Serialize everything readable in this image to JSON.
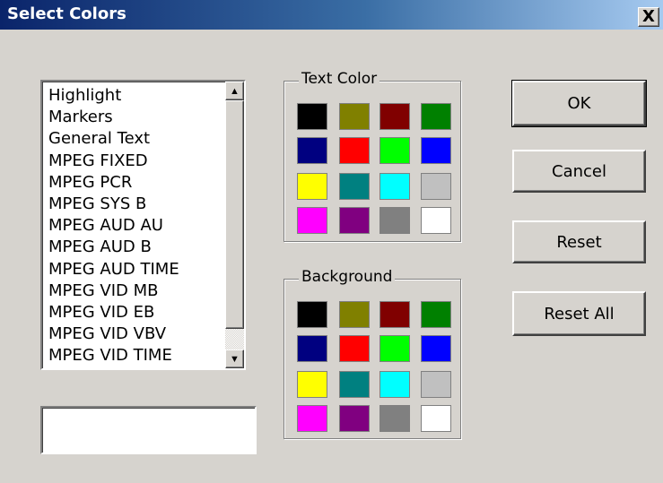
{
  "dialog": {
    "title": "Select Colors",
    "close_glyph": "X"
  },
  "list": {
    "items": [
      "Highlight",
      "Markers",
      "General Text",
      "MPEG FIXED",
      "MPEG PCR",
      "MPEG SYS B",
      "MPEG AUD AU",
      "MPEG AUD B",
      "MPEG AUD TIME",
      "MPEG VID MB",
      "MPEG VID EB",
      "MPEG VID VBV",
      "MPEG VID TIME"
    ]
  },
  "text_color": {
    "label": "Text Color",
    "swatches": [
      "#000000",
      "#808000",
      "#800000",
      "#008000",
      "#000080",
      "#ff0000",
      "#00ff00",
      "#0000ff",
      "#ffff00",
      "#008080",
      "#00ffff",
      "#c0c0c0",
      "#ff00ff",
      "#800080",
      "#808080",
      "#ffffff"
    ]
  },
  "background": {
    "label": "Background",
    "swatches": [
      "#000000",
      "#808000",
      "#800000",
      "#008000",
      "#000080",
      "#ff0000",
      "#00ff00",
      "#0000ff",
      "#ffff00",
      "#008080",
      "#00ffff",
      "#c0c0c0",
      "#ff00ff",
      "#800080",
      "#808080",
      "#ffffff"
    ]
  },
  "buttons": {
    "ok": "OK",
    "cancel": "Cancel",
    "reset": "Reset",
    "reset_all": "Reset All"
  },
  "icons": {
    "scroll_up": "scroll-up-arrow-icon",
    "scroll_down": "scroll-down-arrow-icon"
  }
}
